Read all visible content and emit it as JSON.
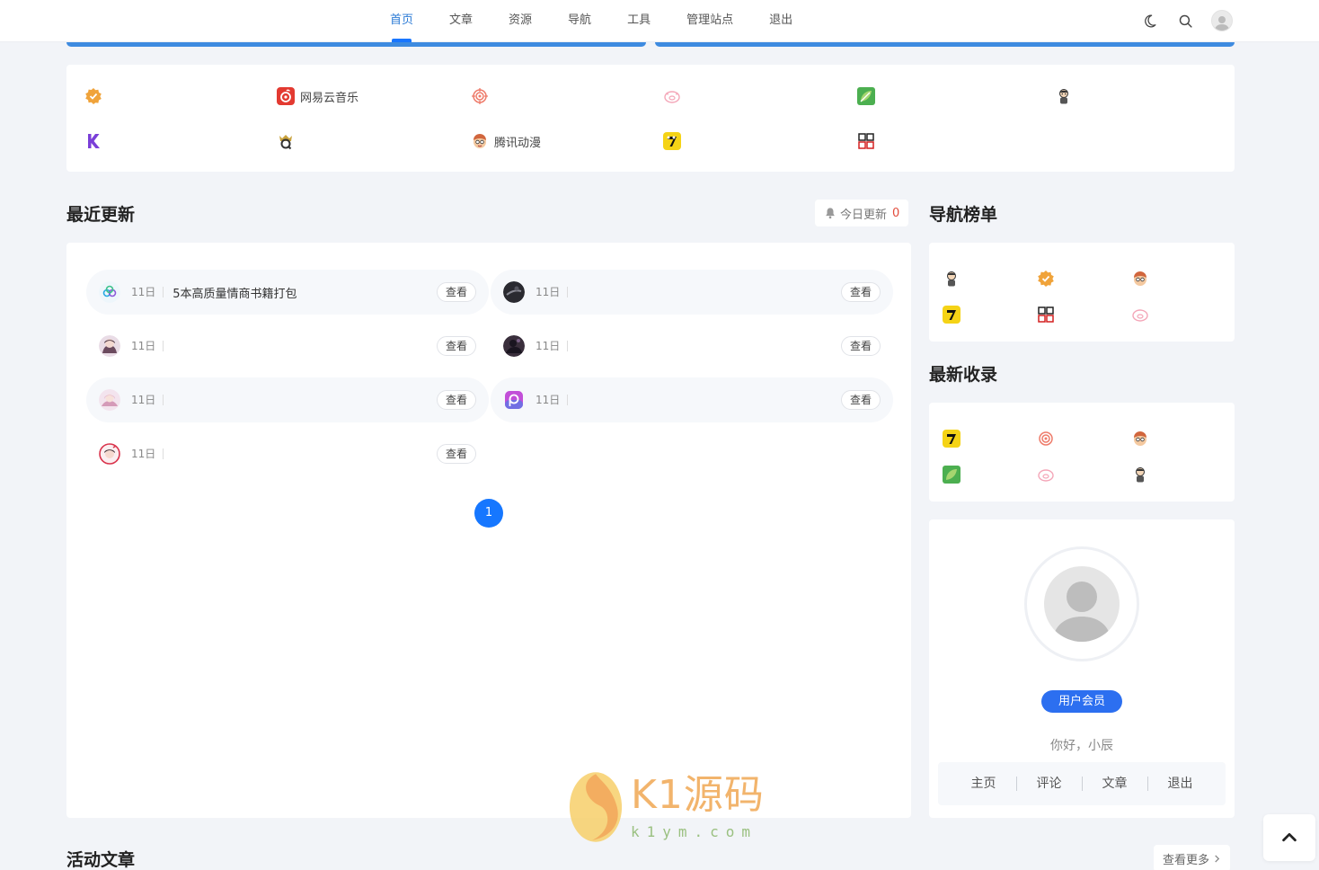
{
  "nav": {
    "items": [
      {
        "label": "首页",
        "active": true
      },
      {
        "label": "文章"
      },
      {
        "label": "资源"
      },
      {
        "label": "导航"
      },
      {
        "label": "工具"
      },
      {
        "label": "管理站点"
      },
      {
        "label": "退出"
      }
    ],
    "tools": [
      "moon-icon",
      "search-icon",
      "user-avatar"
    ]
  },
  "quick_links": [
    {
      "label": "",
      "icon": "badge-check-icon"
    },
    {
      "label": "网易云音乐",
      "icon": "netease-music-icon"
    },
    {
      "label": "",
      "icon": "target-icon"
    },
    {
      "label": "",
      "icon": "pig-icon"
    },
    {
      "label": "",
      "icon": "green-leaf-icon"
    },
    {
      "label": "",
      "icon": "cartoon-character-icon"
    },
    {
      "label": "",
      "icon": "k-logo-icon"
    },
    {
      "label": "",
      "icon": "q-logo-icon"
    },
    {
      "label": "腾讯动漫",
      "icon": "tencent-comic-icon"
    },
    {
      "label": "",
      "icon": "seven-logo-icon"
    },
    {
      "label": "",
      "icon": "xiaodao-yule-icon"
    }
  ],
  "recent": {
    "title": "最近更新",
    "today_label": "今日更新",
    "today_count": "0",
    "view_label": "查看",
    "rows": [
      {
        "date": "11日",
        "title": "5本高质量情商书籍打包",
        "icon": "cloud-logo-icon"
      },
      {
        "date": "11日",
        "title": "",
        "icon": "dark-photo-icon"
      },
      {
        "date": "11日",
        "title": "",
        "icon": "anime-avatar-icon"
      },
      {
        "date": "11日",
        "title": "",
        "icon": "dark-figure-icon"
      },
      {
        "date": "11日",
        "title": "",
        "icon": "anime-girl-icon"
      },
      {
        "date": "11日",
        "title": "",
        "icon": "picsart-icon"
      },
      {
        "date": "11日",
        "title": "",
        "icon": "anime-circle-icon"
      }
    ],
    "page": "1"
  },
  "sidebar": {
    "rank_title": "导航榜单",
    "rank_icons": [
      "cartoon-character-icon",
      "badge-check-icon",
      "tencent-comic-icon",
      "seven-logo-icon",
      "xiaodao-yule-icon",
      "pig-icon"
    ],
    "new_title": "最新收录",
    "new_icons": [
      "seven-logo-icon",
      "target-icon",
      "tencent-comic-icon",
      "green-leaf-icon",
      "pig-icon",
      "cartoon-character-icon"
    ],
    "user": {
      "vip_label": "用户会员",
      "greeting": "你好，小辰",
      "links": [
        "主页",
        "评论",
        "文章",
        "退出"
      ]
    }
  },
  "articles": {
    "title": "活动文章",
    "more_label": "查看更多"
  },
  "watermark": {
    "main": "K1源码",
    "sub": "k1ym.com"
  },
  "colors": {
    "accent": "#1677ff",
    "nav_active": "#2b7bd6",
    "background": "#f2f4f8",
    "count_red": "#e24b3b"
  }
}
